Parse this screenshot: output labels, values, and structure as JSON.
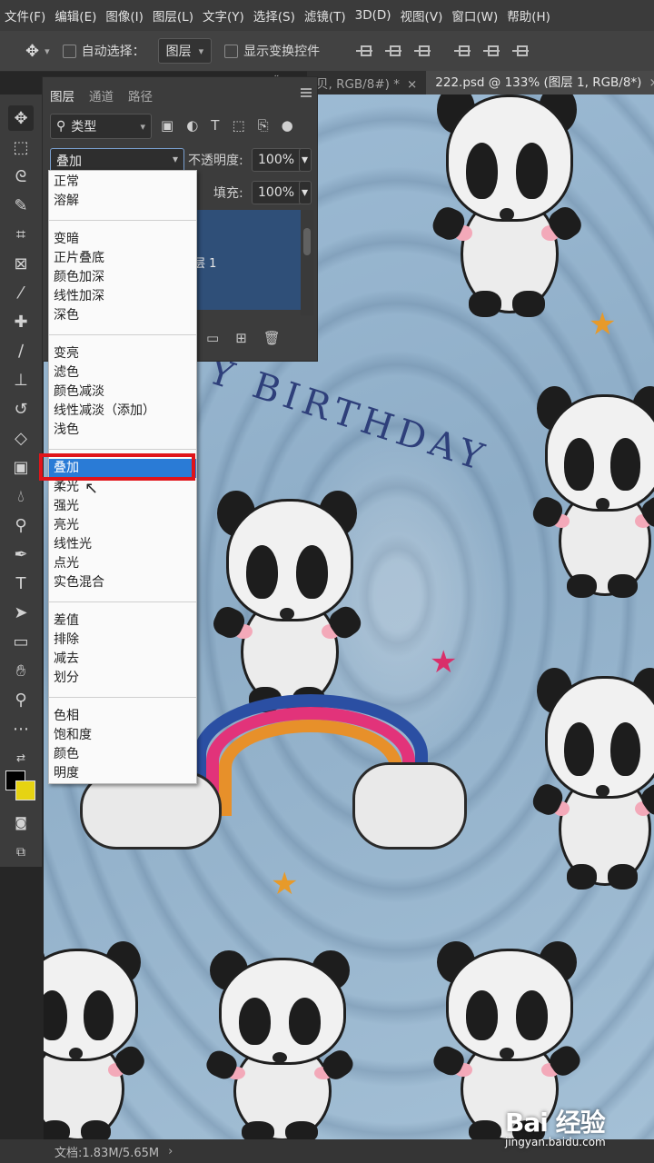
{
  "menubar": {
    "items": [
      "文件(F)",
      "编辑(E)",
      "图像(I)",
      "图层(L)",
      "文字(Y)",
      "选择(S)",
      "滤镜(T)",
      "3D(D)",
      "视图(V)",
      "窗口(W)",
      "帮助(H)"
    ]
  },
  "options_bar": {
    "auto_select_label": "自动选择：",
    "auto_select_value": "图层",
    "show_transform_label": "显示变换控件"
  },
  "doc_tabs": [
    {
      "label": "贝, RGB/8#) *",
      "close": "×"
    },
    {
      "label": "222.psd @ 133% (图层 1, RGB/8*)",
      "close": "×"
    }
  ],
  "layers_panel": {
    "tabs": [
      "图层",
      "通道",
      "路径"
    ],
    "filter_value": "类型",
    "blend_mode_value": "叠加",
    "opacity_label": "不透明度:",
    "opacity_value": "100%",
    "fill_label": "填充:",
    "fill_value": "100%",
    "layer_name_partial": "层 1"
  },
  "blend_menu": {
    "groups": [
      [
        "正常",
        "溶解"
      ],
      [
        "变暗",
        "正片叠底",
        "颜色加深",
        "线性加深",
        "深色"
      ],
      [
        "变亮",
        "滤色",
        "颜色减淡",
        "线性减淡（添加）",
        "浅色"
      ],
      [
        "叠加",
        "柔光",
        "强光",
        "亮光",
        "线性光",
        "点光",
        "实色混合"
      ],
      [
        "差值",
        "排除",
        "减去",
        "划分"
      ],
      [
        "色相",
        "饱和度",
        "颜色",
        "明度"
      ]
    ],
    "selected": "叠加"
  },
  "canvas": {
    "printed_text": "BIRTHDAY",
    "printed_text_prefix": "Y"
  },
  "statusbar": {
    "doc_info": "文档:1.83M/5.65M",
    "arrow": "›"
  },
  "watermark": {
    "logo": "Bai  经验",
    "site": "jingyan.baidu.com"
  },
  "colors": {
    "foreground": "#000000",
    "background": "#e6d312",
    "selection_blue": "#2a7bd6",
    "highlight_red": "#e0141a"
  }
}
